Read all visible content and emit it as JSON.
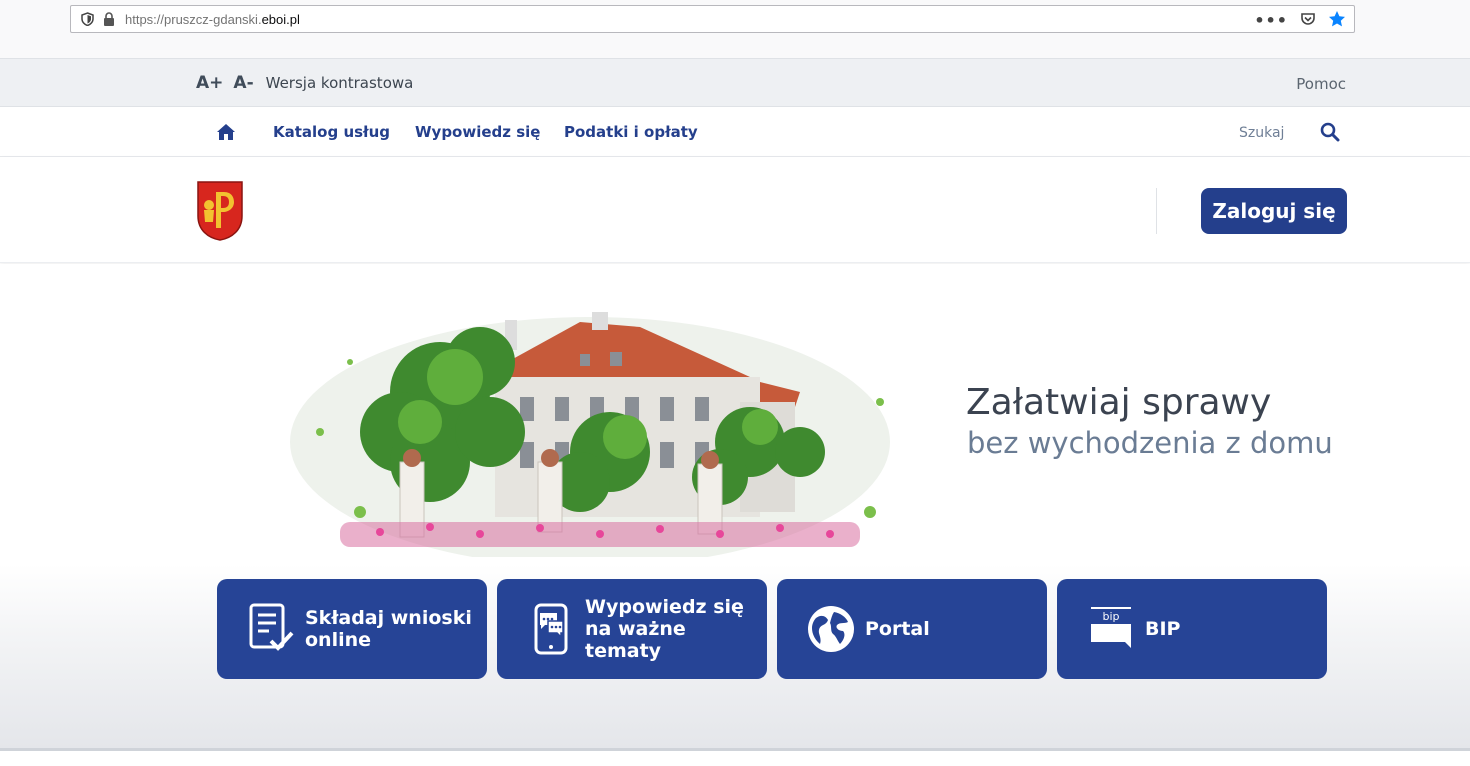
{
  "browser": {
    "url_prefix": "https://pruszcz-gdanski.",
    "url_host": "eboi.pl",
    "menu_dots": "•••"
  },
  "util": {
    "font_increase": "A+",
    "font_decrease": "A-",
    "contrast": "Wersja kontrastowa",
    "help": "Pomoc"
  },
  "nav": {
    "items": [
      "Katalog usług",
      "Wypowiedz się",
      "Podatki i opłaty"
    ],
    "search_label": "Szukaj"
  },
  "header": {
    "login": "Zaloguj się"
  },
  "hero": {
    "title": "Załatwiaj sprawy",
    "subtitle": "bez wychodzenia z domu"
  },
  "tiles": [
    {
      "line1": "Składaj wnioski",
      "line2": "online",
      "line3": ""
    },
    {
      "line1": "Wypowiedz się",
      "line2": "na ważne",
      "line3": "tematy"
    },
    {
      "line1": "Portal",
      "line2": "",
      "line3": ""
    },
    {
      "line1": "BIP",
      "line2": "",
      "line3": ""
    }
  ],
  "bip_icon_text": "bip",
  "colors": {
    "brand": "#243f8c",
    "tile": "#264496"
  }
}
